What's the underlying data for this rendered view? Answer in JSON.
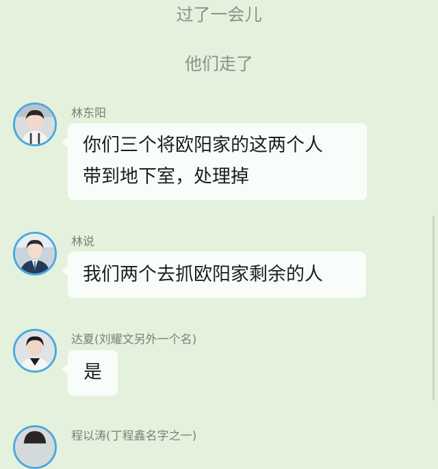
{
  "narration": [
    "过了一会儿",
    "他们走了"
  ],
  "messages": [
    {
      "sender": "林东阳",
      "lines": [
        "你们三个将欧阳家的这两个人",
        "带到地下室，处理掉"
      ]
    },
    {
      "sender": "林说",
      "lines": [
        "我们两个去抓欧阳家剩余的人"
      ]
    },
    {
      "sender": "达夏(刘耀文另外一个名)",
      "lines": [
        "是"
      ]
    },
    {
      "sender": "程以涛(丁程鑫名字之一)",
      "lines": []
    }
  ]
}
